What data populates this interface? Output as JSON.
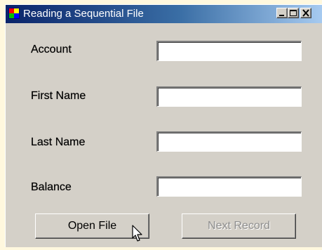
{
  "window": {
    "title": "Reading a Sequential File",
    "controls": {
      "minimize": "minimize-icon",
      "maximize": "maximize-icon",
      "close": "close-icon"
    }
  },
  "form": {
    "fields": [
      {
        "label": "Account",
        "value": ""
      },
      {
        "label": "First Name",
        "value": ""
      },
      {
        "label": "Last Name",
        "value": ""
      },
      {
        "label": "Balance",
        "value": ""
      }
    ],
    "open_button": "Open File",
    "next_button": "Next Record",
    "next_button_enabled": false
  },
  "colors": {
    "titlebar_start": "#0A246A",
    "titlebar_end": "#A6CAF0",
    "window_face": "#D4D0C8",
    "background": "#FFF8DE",
    "disabled_text": "#8E8E8E"
  }
}
